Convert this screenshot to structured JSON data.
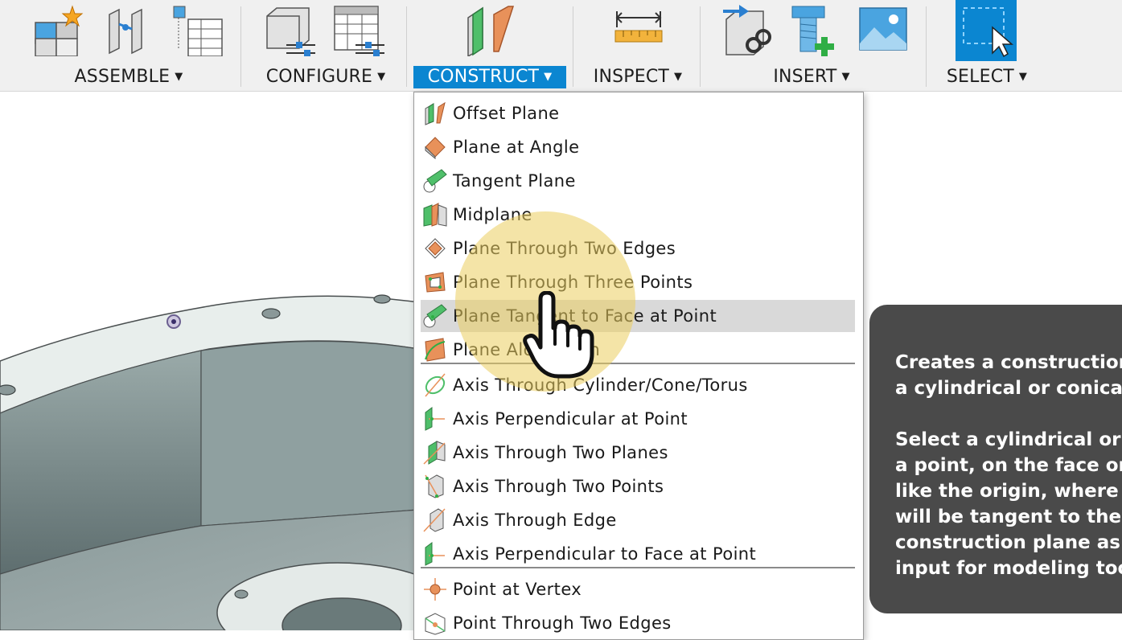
{
  "toolbar": {
    "groups": [
      {
        "label": "ASSEMBLE"
      },
      {
        "label": "CONFIGURE"
      },
      {
        "label": "CONSTRUCT"
      },
      {
        "label": "INSPECT"
      },
      {
        "label": "INSERT"
      },
      {
        "label": "SELECT"
      }
    ],
    "active_group": "CONSTRUCT",
    "accent_color": "#0b86d1"
  },
  "construct_menu": {
    "items": [
      {
        "label": "Offset Plane",
        "icon": "offset-plane-icon"
      },
      {
        "label": "Plane at Angle",
        "icon": "plane-at-angle-icon"
      },
      {
        "label": "Tangent Plane",
        "icon": "tangent-plane-icon"
      },
      {
        "label": "Midplane",
        "icon": "midplane-icon"
      },
      {
        "label": "Plane Through Two Edges",
        "icon": "plane-two-edges-icon"
      },
      {
        "label": "Plane Through Three Points",
        "icon": "plane-three-points-icon"
      },
      {
        "label": "Plane Tangent to Face at Point",
        "icon": "plane-tangent-face-point-icon",
        "highlighted": true
      },
      {
        "label": "Plane Along Path",
        "icon": "plane-along-path-icon"
      },
      {
        "label": "Axis Through Cylinder/Cone/Torus",
        "icon": "axis-cylinder-icon"
      },
      {
        "label": "Axis Perpendicular at Point",
        "icon": "axis-perpendicular-point-icon"
      },
      {
        "label": "Axis Through Two Planes",
        "icon": "axis-two-planes-icon"
      },
      {
        "label": "Axis Through Two Points",
        "icon": "axis-two-points-icon"
      },
      {
        "label": "Axis Through Edge",
        "icon": "axis-edge-icon"
      },
      {
        "label": "Axis Perpendicular to Face at Point",
        "icon": "axis-perpendicular-face-icon"
      },
      {
        "label": "Point at Vertex",
        "icon": "point-vertex-icon"
      },
      {
        "label": "Point Through Two Edges",
        "icon": "point-two-edges-icon"
      }
    ]
  },
  "tooltip": {
    "line1": "Creates a construction",
    "line2": "a cylindrical or conical",
    "line3": "Select a cylindrical or c",
    "line4": "a point, on the face or",
    "line5": "like the origin, where t",
    "line6": "will be tangent to the f",
    "line7": "construction plane as",
    "line8": "input for modeling too"
  }
}
